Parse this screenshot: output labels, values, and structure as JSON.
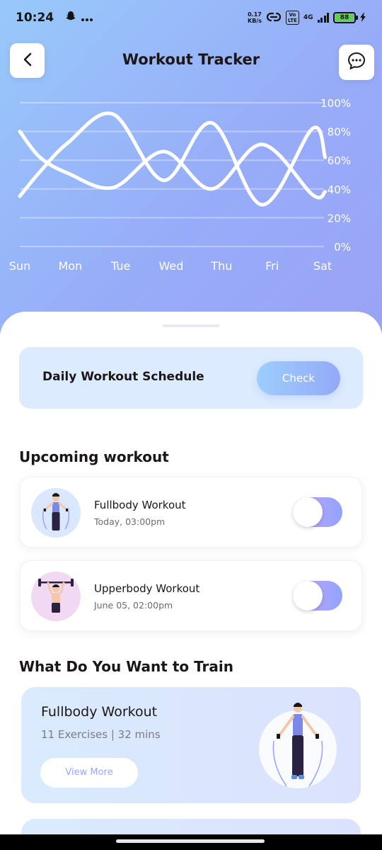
{
  "status_bar": {
    "time": "10:24",
    "net_speed_value": "0.17",
    "net_speed_unit": "KB/s",
    "volte_top": "Vo",
    "volte_bottom": "LTE",
    "network": "4G",
    "battery": "88"
  },
  "header": {
    "title": "Workout Tracker",
    "back_icon": "chevron-left-icon",
    "chat_icon": "chat-bubble-icon"
  },
  "chart_data": {
    "type": "line",
    "categories": [
      "Sun",
      "Mon",
      "Tue",
      "Wed",
      "Thu",
      "Fri",
      "Sat"
    ],
    "y_tick_labels": [
      "100%",
      "80%",
      "60%",
      "40%",
      "20%",
      "0%"
    ],
    "ylim": [
      0,
      100
    ],
    "grid": true,
    "series": [
      {
        "x": [
          0.0,
          0.4,
          0.95,
          1.85,
          2.85,
          3.8,
          4.8,
          5.8,
          6.05
        ],
        "values": [
          35,
          52,
          72,
          92,
          46,
          86,
          29,
          82,
          62
        ]
      },
      {
        "x": [
          0.0,
          0.4,
          0.95,
          1.85,
          2.85,
          3.8,
          4.8,
          5.8,
          6.05
        ],
        "values": [
          80,
          62,
          51,
          41,
          66,
          40,
          71,
          36,
          38
        ]
      }
    ]
  },
  "schedule": {
    "label": "Daily Workout Schedule",
    "button": "Check"
  },
  "upcoming": {
    "title": "Upcoming workout",
    "items": [
      {
        "title": "Fullbody Workout",
        "time": "Today, 03:00pm",
        "enabled": true
      },
      {
        "title": "Upperbody Workout",
        "time": "June 05, 02:00pm",
        "enabled": true
      }
    ]
  },
  "train": {
    "title": "What Do You Want to Train",
    "cards": [
      {
        "title": "Fullbody Workout",
        "subtitle": "11 Exercises | 32 mins",
        "button": "View More"
      }
    ]
  },
  "colors": {
    "hero_start": "#98c9fb",
    "hero_end": "#9aa3f6",
    "accent": "#92a3fd",
    "card_bg": "#dcebfd"
  }
}
